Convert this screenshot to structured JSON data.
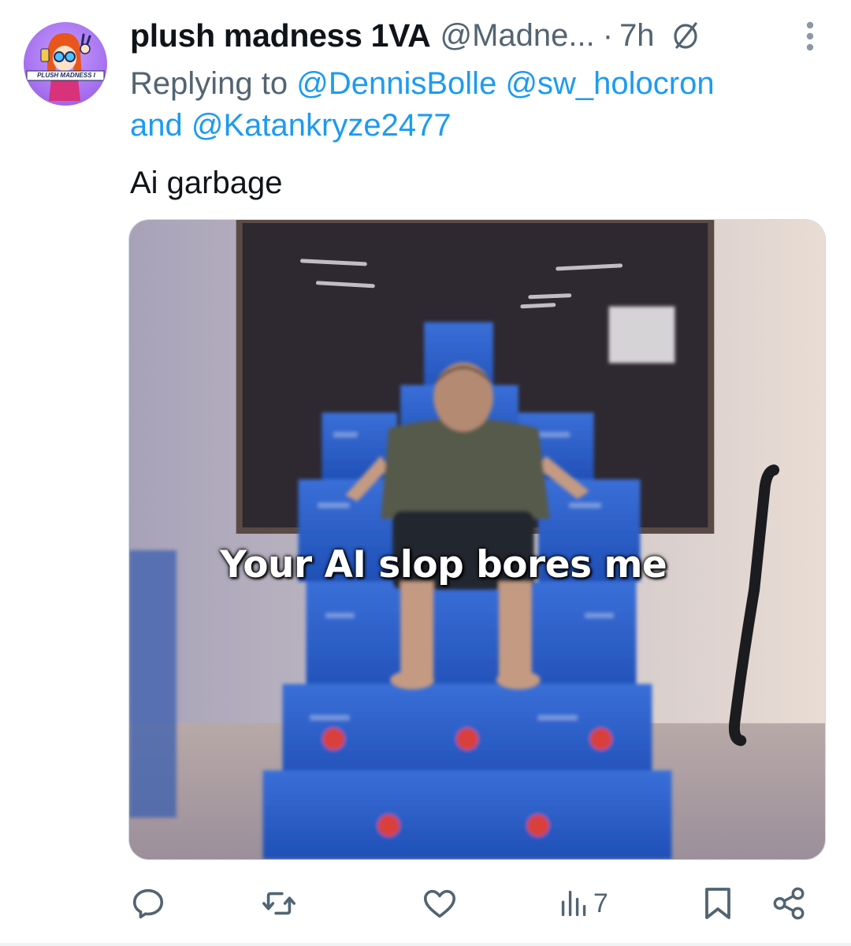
{
  "tweet": {
    "display_name": "plush madness 1VA",
    "handle": "@Madne...",
    "separator": "·",
    "time": "7h",
    "avatar_text": "PLUSH MADNESS I",
    "replying_prefix": "Replying to",
    "replying_mentions": [
      "@DennisBolle",
      "@sw_holocron"
    ],
    "replying_and": "and",
    "replying_last": "@Katankryze2477",
    "text": "Ai garbage",
    "media_caption": "Your AI slop bores me"
  },
  "actions": {
    "reply_icon": "reply-icon",
    "retweet_icon": "retweet-icon",
    "like_icon": "heart-icon",
    "views_icon": "views-icon",
    "views_count": "7",
    "bookmark_icon": "bookmark-icon",
    "share_icon": "share-icon"
  },
  "colors": {
    "text_primary": "#0f1419",
    "text_secondary": "#536471",
    "link": "#1d9bf0",
    "avatar_bg": "#a874f0"
  }
}
